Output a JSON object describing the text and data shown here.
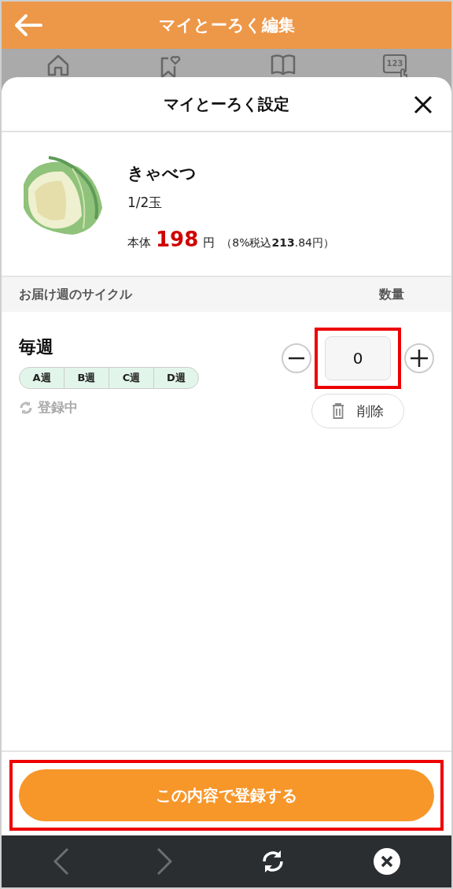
{
  "header": {
    "title": "マイとーろく編集"
  },
  "nav": {
    "items": [
      {
        "kind": "home"
      },
      {
        "kind": "bookmark"
      },
      {
        "kind": "book"
      },
      {
        "kind": "number",
        "label": "123"
      }
    ]
  },
  "sheet": {
    "title": "マイとーろく設定"
  },
  "product": {
    "name": "きゃべつ",
    "unit": "1/2玉",
    "price_prefix": "本体",
    "price": "198",
    "price_suffix": "円",
    "tax_note": "（8%税込**213**.84円）"
  },
  "table": {
    "columns": [
      "お届け週のサイクル",
      "数量"
    ]
  },
  "cycle": {
    "name": "毎週",
    "weeks": [
      {
        "label": "A週"
      },
      {
        "label": "B週"
      },
      {
        "label": "C週"
      },
      {
        "label": "D週"
      }
    ],
    "status": "登録中",
    "quantity": "0",
    "quantity_highlighted": true,
    "delete": "削除"
  },
  "submit": {
    "label": "この内容で登録する",
    "highlighted": true
  },
  "toolbar": {
    "back_disabled": true,
    "forward_disabled": true
  }
}
